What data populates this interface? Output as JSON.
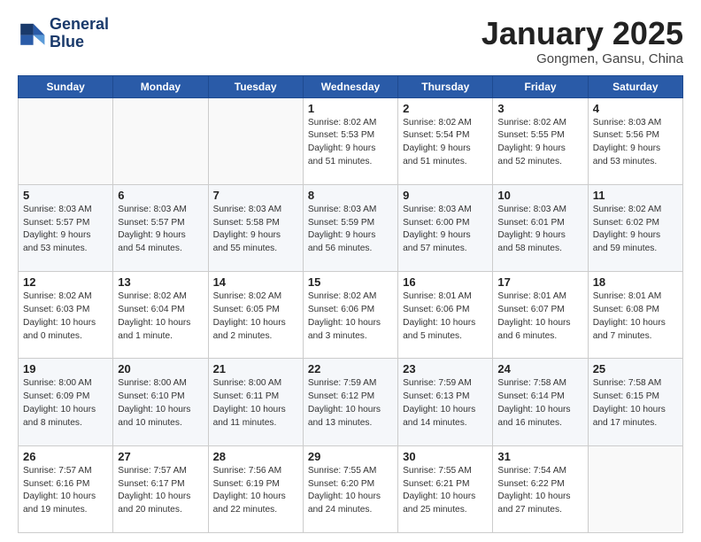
{
  "header": {
    "logo_line1": "General",
    "logo_line2": "Blue",
    "month_title": "January 2025",
    "location": "Gongmen, Gansu, China"
  },
  "weekdays": [
    "Sunday",
    "Monday",
    "Tuesday",
    "Wednesday",
    "Thursday",
    "Friday",
    "Saturday"
  ],
  "weeks": [
    [
      {
        "day": "",
        "info": ""
      },
      {
        "day": "",
        "info": ""
      },
      {
        "day": "",
        "info": ""
      },
      {
        "day": "1",
        "info": "Sunrise: 8:02 AM\nSunset: 5:53 PM\nDaylight: 9 hours\nand 51 minutes."
      },
      {
        "day": "2",
        "info": "Sunrise: 8:02 AM\nSunset: 5:54 PM\nDaylight: 9 hours\nand 51 minutes."
      },
      {
        "day": "3",
        "info": "Sunrise: 8:02 AM\nSunset: 5:55 PM\nDaylight: 9 hours\nand 52 minutes."
      },
      {
        "day": "4",
        "info": "Sunrise: 8:03 AM\nSunset: 5:56 PM\nDaylight: 9 hours\nand 53 minutes."
      }
    ],
    [
      {
        "day": "5",
        "info": "Sunrise: 8:03 AM\nSunset: 5:57 PM\nDaylight: 9 hours\nand 53 minutes."
      },
      {
        "day": "6",
        "info": "Sunrise: 8:03 AM\nSunset: 5:57 PM\nDaylight: 9 hours\nand 54 minutes."
      },
      {
        "day": "7",
        "info": "Sunrise: 8:03 AM\nSunset: 5:58 PM\nDaylight: 9 hours\nand 55 minutes."
      },
      {
        "day": "8",
        "info": "Sunrise: 8:03 AM\nSunset: 5:59 PM\nDaylight: 9 hours\nand 56 minutes."
      },
      {
        "day": "9",
        "info": "Sunrise: 8:03 AM\nSunset: 6:00 PM\nDaylight: 9 hours\nand 57 minutes."
      },
      {
        "day": "10",
        "info": "Sunrise: 8:03 AM\nSunset: 6:01 PM\nDaylight: 9 hours\nand 58 minutes."
      },
      {
        "day": "11",
        "info": "Sunrise: 8:02 AM\nSunset: 6:02 PM\nDaylight: 9 hours\nand 59 minutes."
      }
    ],
    [
      {
        "day": "12",
        "info": "Sunrise: 8:02 AM\nSunset: 6:03 PM\nDaylight: 10 hours\nand 0 minutes."
      },
      {
        "day": "13",
        "info": "Sunrise: 8:02 AM\nSunset: 6:04 PM\nDaylight: 10 hours\nand 1 minute."
      },
      {
        "day": "14",
        "info": "Sunrise: 8:02 AM\nSunset: 6:05 PM\nDaylight: 10 hours\nand 2 minutes."
      },
      {
        "day": "15",
        "info": "Sunrise: 8:02 AM\nSunset: 6:06 PM\nDaylight: 10 hours\nand 3 minutes."
      },
      {
        "day": "16",
        "info": "Sunrise: 8:01 AM\nSunset: 6:06 PM\nDaylight: 10 hours\nand 5 minutes."
      },
      {
        "day": "17",
        "info": "Sunrise: 8:01 AM\nSunset: 6:07 PM\nDaylight: 10 hours\nand 6 minutes."
      },
      {
        "day": "18",
        "info": "Sunrise: 8:01 AM\nSunset: 6:08 PM\nDaylight: 10 hours\nand 7 minutes."
      }
    ],
    [
      {
        "day": "19",
        "info": "Sunrise: 8:00 AM\nSunset: 6:09 PM\nDaylight: 10 hours\nand 8 minutes."
      },
      {
        "day": "20",
        "info": "Sunrise: 8:00 AM\nSunset: 6:10 PM\nDaylight: 10 hours\nand 10 minutes."
      },
      {
        "day": "21",
        "info": "Sunrise: 8:00 AM\nSunset: 6:11 PM\nDaylight: 10 hours\nand 11 minutes."
      },
      {
        "day": "22",
        "info": "Sunrise: 7:59 AM\nSunset: 6:12 PM\nDaylight: 10 hours\nand 13 minutes."
      },
      {
        "day": "23",
        "info": "Sunrise: 7:59 AM\nSunset: 6:13 PM\nDaylight: 10 hours\nand 14 minutes."
      },
      {
        "day": "24",
        "info": "Sunrise: 7:58 AM\nSunset: 6:14 PM\nDaylight: 10 hours\nand 16 minutes."
      },
      {
        "day": "25",
        "info": "Sunrise: 7:58 AM\nSunset: 6:15 PM\nDaylight: 10 hours\nand 17 minutes."
      }
    ],
    [
      {
        "day": "26",
        "info": "Sunrise: 7:57 AM\nSunset: 6:16 PM\nDaylight: 10 hours\nand 19 minutes."
      },
      {
        "day": "27",
        "info": "Sunrise: 7:57 AM\nSunset: 6:17 PM\nDaylight: 10 hours\nand 20 minutes."
      },
      {
        "day": "28",
        "info": "Sunrise: 7:56 AM\nSunset: 6:19 PM\nDaylight: 10 hours\nand 22 minutes."
      },
      {
        "day": "29",
        "info": "Sunrise: 7:55 AM\nSunset: 6:20 PM\nDaylight: 10 hours\nand 24 minutes."
      },
      {
        "day": "30",
        "info": "Sunrise: 7:55 AM\nSunset: 6:21 PM\nDaylight: 10 hours\nand 25 minutes."
      },
      {
        "day": "31",
        "info": "Sunrise: 7:54 AM\nSunset: 6:22 PM\nDaylight: 10 hours\nand 27 minutes."
      },
      {
        "day": "",
        "info": ""
      }
    ]
  ]
}
